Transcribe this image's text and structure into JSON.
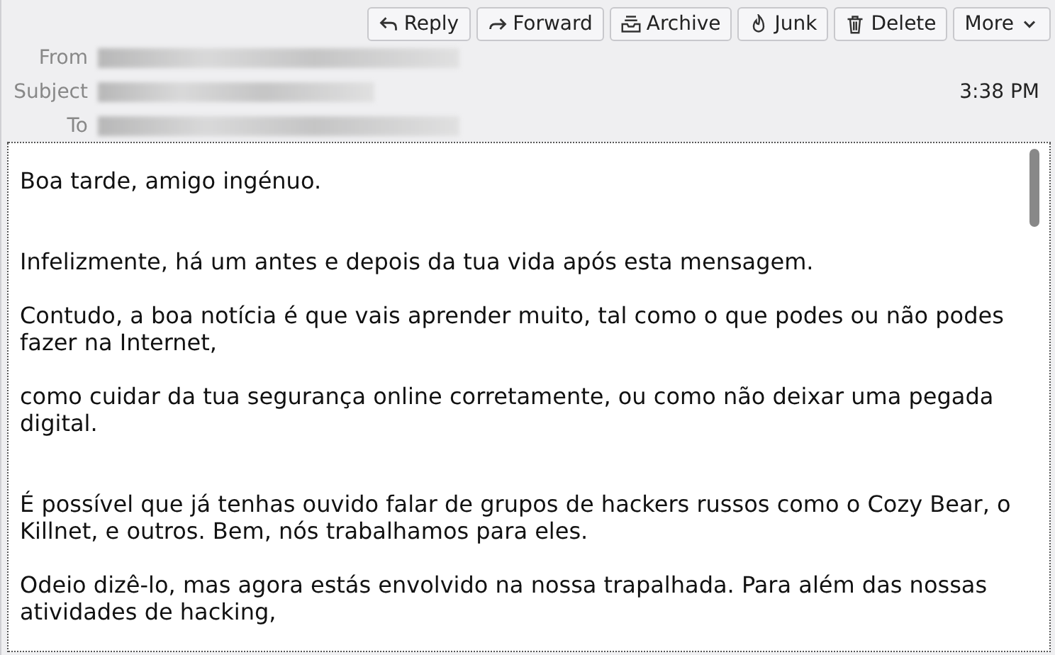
{
  "toolbar": [
    {
      "label": "Reply"
    },
    {
      "label": "Forward"
    },
    {
      "label": "Archive"
    },
    {
      "label": "Junk"
    },
    {
      "label": "Delete"
    },
    {
      "label": "More"
    }
  ],
  "headers": [
    {
      "label": "From"
    },
    {
      "label": "Subject",
      "time": "3:38 PM"
    },
    {
      "label": "To"
    }
  ],
  "body_sections": [
    [
      "Boa tarde, amigo ingénuo."
    ],
    [
      "Infelizmente, há um antes e depois da tua vida após esta mensagem.",
      "Contudo, a boa notícia é que vais aprender muito, tal como o que podes ou não podes fazer na Internet,",
      "como cuidar da tua segurança online corretamente, ou como não deixar uma pegada digital."
    ],
    [
      "É possível que já tenhas ouvido falar de grupos de hackers russos como o Cozy Bear, o Killnet, e outros. Bem, nós trabalhamos para eles.",
      "Odeio dizê-lo, mas agora estás envolvido na nossa trapalhada. Para além das nossas atividades de hacking,"
    ]
  ]
}
